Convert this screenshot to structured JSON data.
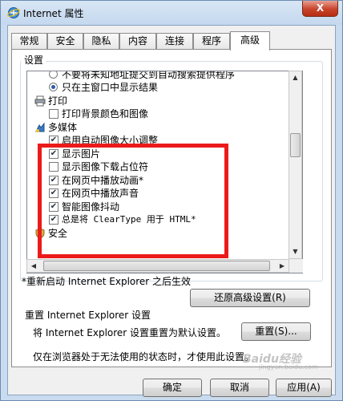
{
  "window": {
    "title": "Internet 属性",
    "close_label": "X"
  },
  "tabs": [
    "常规",
    "安全",
    "隐私",
    "内容",
    "连接",
    "程序",
    "高级"
  ],
  "active_tab": "高级",
  "settings_group_label": "设置",
  "settings_list": {
    "rows": [
      {
        "kind": "radio",
        "checked": false,
        "label": "不要将未知地址提交到自动搜索提供程序"
      },
      {
        "kind": "radio",
        "checked": true,
        "label": "只在主窗口中显示结果"
      },
      {
        "kind": "category",
        "icon": "printer-icon",
        "label": "打印"
      },
      {
        "kind": "checkbox",
        "checked": false,
        "label": "打印背景颜色和图像"
      },
      {
        "kind": "category",
        "icon": "multimedia-icon",
        "label": "多媒体"
      },
      {
        "kind": "checkbox",
        "checked": true,
        "label": "启用自动图像大小调整"
      },
      {
        "kind": "checkbox",
        "checked": true,
        "label": "显示图片"
      },
      {
        "kind": "checkbox",
        "checked": false,
        "label": "显示图像下载占位符"
      },
      {
        "kind": "checkbox",
        "checked": true,
        "label": "在网页中播放动画*"
      },
      {
        "kind": "checkbox",
        "checked": true,
        "label": "在网页中播放声音"
      },
      {
        "kind": "checkbox",
        "checked": true,
        "label": "智能图像抖动"
      },
      {
        "kind": "checkbox",
        "checked": true,
        "label": "总是将 ClearType 用于 HTML*"
      },
      {
        "kind": "category",
        "icon": "security-icon",
        "label": "安全"
      }
    ]
  },
  "restart_note": "*重新启动 Internet Explorer 之后生效",
  "restore_button": "还原高级设置(R)",
  "reset_section": {
    "title": "重置 Internet Explorer 设置",
    "description": "将 Internet Explorer 设置重置为默认设置。",
    "reset_button": "重置(S)...",
    "hint": "仅在浏览器处于无法使用的状态时，才使用此设置。"
  },
  "footer": {
    "ok": "确定",
    "cancel": "取消",
    "apply": "应用(A)"
  },
  "watermark": {
    "text": "Baidu经验",
    "sub": "jingyan.baidu.com"
  },
  "colors": {
    "highlight": "#ec1a1a",
    "title_bar": "#c9dbee",
    "close_button": "#c7432b"
  }
}
